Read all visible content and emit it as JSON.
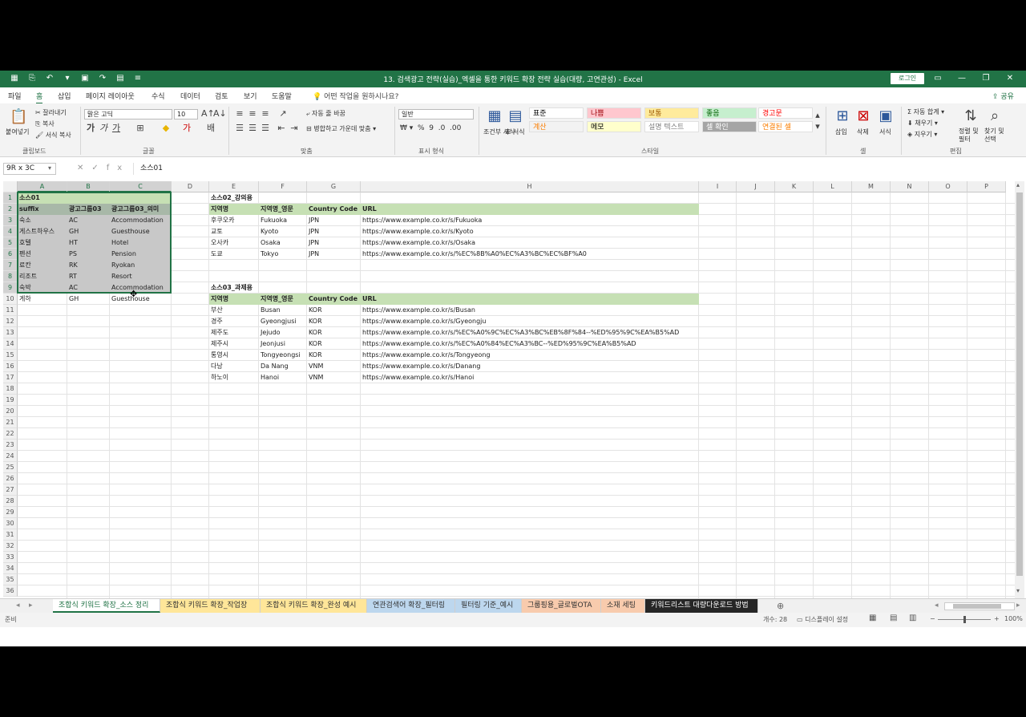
{
  "window": {
    "title": "13. 검색광고 전략(실습)_엑셀을 통한 키워드 확장 전략 실습(대량, 고연관성)  -  Excel",
    "login_label": "로그인",
    "share_label": "공유"
  },
  "menu": {
    "tabs": [
      "파일",
      "홈",
      "삽입",
      "페이지 레이아웃",
      "수식",
      "데이터",
      "검토",
      "보기",
      "도움말"
    ],
    "active": "홈",
    "tell_me": "어떤 작업을 원하시나요?"
  },
  "ribbon": {
    "clipboard": {
      "label": "클립보드",
      "paste": "붙여넣기",
      "cut": "잘라내기",
      "copy": "복사",
      "format_painter": "서식 복사"
    },
    "font": {
      "label": "글꼴",
      "font_name": "맑은 고딕",
      "font_size": "10"
    },
    "alignment": {
      "label": "맞춤",
      "wrap": "자동 줄 바꿈",
      "merge": "병합하고 가운데 맞춤"
    },
    "number": {
      "label": "표시 형식",
      "format": "일반"
    },
    "styles": {
      "label": "스타일",
      "conditional": "조건부 서식",
      "table": "표 서식",
      "cells": [
        {
          "name": "표준",
          "color": "#000000",
          "bg": "#ffffff"
        },
        {
          "name": "나쁨",
          "color": "#9c0006",
          "bg": "#ffc7ce"
        },
        {
          "name": "보통",
          "color": "#9c5700",
          "bg": "#ffeb9c"
        },
        {
          "name": "좋음",
          "color": "#006100",
          "bg": "#c6efce"
        },
        {
          "name": "경고문",
          "color": "#ff0000",
          "bg": "#ffffff"
        },
        {
          "name": "계산",
          "color": "#fa7d00",
          "bg": "#f2f2f2"
        },
        {
          "name": "메모",
          "color": "#000000",
          "bg": "#ffffcc"
        },
        {
          "name": "설명 텍스트",
          "color": "#7f7f7f",
          "bg": "#ffffff"
        },
        {
          "name": "셀 확인",
          "color": "#ffffff",
          "bg": "#a5a5a5"
        },
        {
          "name": "연결된 셀",
          "color": "#fa7d00",
          "bg": "#ffffff"
        }
      ]
    },
    "cells": {
      "label": "셀",
      "insert": "삽입",
      "delete": "삭제",
      "format": "서식"
    },
    "editing": {
      "label": "편집",
      "autosum": "자동 합계",
      "fill": "채우기",
      "clear": "지우기",
      "sort": "정렬 및 필터",
      "find": "찾기 및 선택"
    }
  },
  "formula_bar": {
    "name_box": "9R x 3C",
    "formula": "소스01"
  },
  "sheet": {
    "columns": [
      "A",
      "B",
      "C",
      "D",
      "E",
      "F",
      "G",
      "H",
      "I",
      "J",
      "K",
      "L",
      "M",
      "N",
      "O",
      "P"
    ],
    "rows": [
      1,
      2,
      3,
      4,
      5,
      6,
      7,
      8,
      9,
      10,
      11,
      12,
      13,
      14,
      15,
      16,
      17,
      18,
      19,
      20,
      21,
      22,
      23,
      24,
      25,
      26,
      27,
      28,
      29,
      30,
      31,
      32,
      33,
      34,
      35,
      36
    ],
    "source01": {
      "title": "소스01",
      "headers": [
        "suffix",
        "광고그룹03",
        "광고그룹03_의미"
      ],
      "rows": [
        [
          "숙소",
          "AC",
          "Accommodation"
        ],
        [
          "게스트하우스",
          "GH",
          "Guesthouse"
        ],
        [
          "호텔",
          "HT",
          "Hotel"
        ],
        [
          "펜션",
          "PS",
          "Pension"
        ],
        [
          "료칸",
          "RK",
          "Ryokan"
        ],
        [
          "리조트",
          "RT",
          "Resort"
        ],
        [
          "숙박",
          "AC",
          "Accommodation"
        ],
        [
          "게하",
          "GH",
          "Guesthouse"
        ]
      ]
    },
    "source02": {
      "title": "소스02_강의용",
      "headers": [
        "지역명",
        "지역명_영문",
        "Country Code",
        "URL"
      ],
      "rows": [
        [
          "후쿠오카",
          "Fukuoka",
          "JPN",
          "https://www.example.co.kr/s/Fukuoka"
        ],
        [
          "교토",
          "Kyoto",
          "JPN",
          "https://www.example.co.kr/s/Kyoto"
        ],
        [
          "오사카",
          "Osaka",
          "JPN",
          "https://www.example.co.kr/s/Osaka"
        ],
        [
          "도쿄",
          "Tokyo",
          "JPN",
          "https://www.example.co.kr/s/%EC%8B%A0%EC%A3%BC%EC%BF%A0"
        ]
      ]
    },
    "source03": {
      "title": "소스03_과제용",
      "headers": [
        "지역명",
        "지역명_영문",
        "Country Code",
        "URL"
      ],
      "rows": [
        [
          "부산",
          "Busan",
          "KOR",
          "https://www.example.co.kr/s/Busan"
        ],
        [
          "경주",
          "Gyeongjusi",
          "KOR",
          "https://www.example.co.kr/s/Gyeongju"
        ],
        [
          "제주도",
          "Jejudo",
          "KOR",
          "https://www.example.co.kr/s/%EC%A0%9C%EC%A3%BC%EB%8F%84--%ED%95%9C%EA%B5%AD"
        ],
        [
          "제주시",
          "Jeonjusi",
          "KOR",
          "https://www.example.co.kr/s/%EC%A0%84%EC%A3%BC--%ED%95%9C%EA%B5%AD"
        ],
        [
          "통영시",
          "Tongyeongsi",
          "KOR",
          "https://www.example.co.kr/s/Tongyeong"
        ],
        [
          "다낭",
          "Da Nang",
          "VNM",
          "https://www.example.co.kr/s/Danang"
        ],
        [
          "하노이",
          "Hanoi",
          "VNM",
          "https://www.example.co.kr/s/Hanoi"
        ]
      ]
    }
  },
  "sheet_tabs": [
    {
      "name": "조합식 키워드 확장_소스 정리",
      "color": "#ffffff",
      "active": true
    },
    {
      "name": "조합식 키워드 확장_작업장",
      "color": "#ffe699"
    },
    {
      "name": "조합식 키워드 확장_완성 예시",
      "color": "#ffe699"
    },
    {
      "name": "연관검색어 확장_필터링",
      "color": "#bdd7ee"
    },
    {
      "name": "필터링 기준_예시",
      "color": "#bdd7ee"
    },
    {
      "name": "그룹핑용_글로벌OTA",
      "color": "#f8cbad"
    },
    {
      "name": "소재 세팅",
      "color": "#f8cbad"
    },
    {
      "name": "키워드리스트 대량다운로드 방법",
      "color": "#262626",
      "text_color": "#ffffff"
    }
  ],
  "status_bar": {
    "mode": "준비",
    "count": "개수: 28",
    "display_settings": "디스플레이 설정",
    "zoom": "100%"
  }
}
